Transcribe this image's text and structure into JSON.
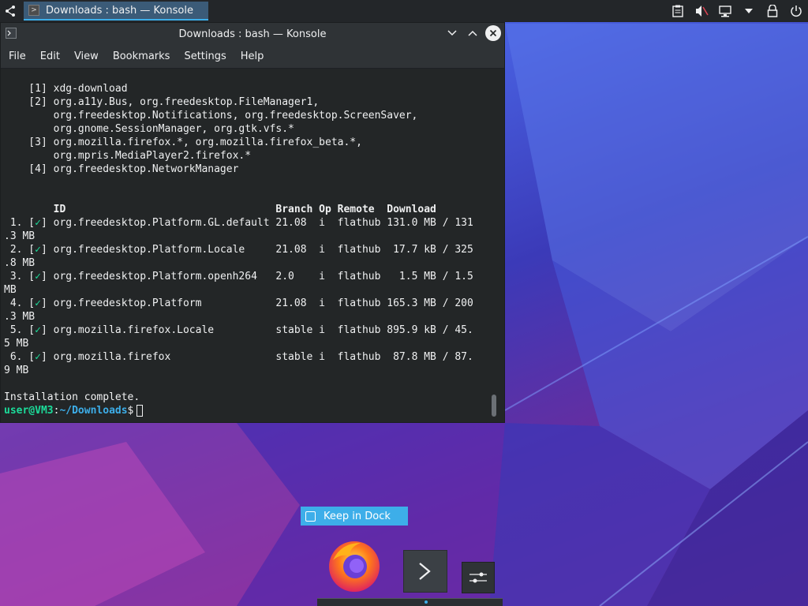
{
  "taskbar": {
    "task_title": "Downloads : bash — Konsole"
  },
  "window": {
    "title": "Downloads : bash — Konsole",
    "menu": [
      "File",
      "Edit",
      "View",
      "Bookmarks",
      "Settings",
      "Help"
    ]
  },
  "terminal": {
    "permission_lines": [
      "    [1] xdg-download",
      "    [2] org.a11y.Bus, org.freedesktop.FileManager1,",
      "        org.freedesktop.Notifications, org.freedesktop.ScreenSaver,",
      "        org.gnome.SessionManager, org.gtk.vfs.*",
      "    [3] org.mozilla.firefox.*, org.mozilla.firefox_beta.*,",
      "        org.mpris.MediaPlayer2.firefox.*",
      "    [4] org.freedesktop.NetworkManager"
    ],
    "table_header": "        ID                                  Branch Op Remote  Download",
    "rows": [
      {
        "prefix": " 1. [",
        "check": "✓",
        "text": "] org.freedesktop.Platform.GL.default 21.08  i  flathub 131.0 MB / 131",
        "wrap": ".3 MB"
      },
      {
        "prefix": " 2. [",
        "check": "✓",
        "text": "] org.freedesktop.Platform.Locale     21.08  i  flathub  17.7 kB / 325",
        "wrap": ".8 MB"
      },
      {
        "prefix": " 3. [",
        "check": "✓",
        "text": "] org.freedesktop.Platform.openh264   2.0    i  flathub   1.5 MB / 1.5",
        "wrap": "MB"
      },
      {
        "prefix": " 4. [",
        "check": "✓",
        "text": "] org.freedesktop.Platform            21.08  i  flathub 165.3 MB / 200",
        "wrap": ".3 MB"
      },
      {
        "prefix": " 5. [",
        "check": "✓",
        "text": "] org.mozilla.firefox.Locale          stable i  flathub 895.9 kB / 45.",
        "wrap": "5 MB"
      },
      {
        "prefix": " 6. [",
        "check": "✓",
        "text": "] org.mozilla.firefox                 stable i  flathub  87.8 MB / 87.",
        "wrap": "9 MB"
      }
    ],
    "status": "Installation complete.",
    "prompt_user": "user@VM3",
    "prompt_sep": ":",
    "prompt_path": "~/Downloads",
    "prompt_end": "$"
  },
  "dock": {
    "keep_in_dock_label": "Keep in Dock"
  },
  "colors": {
    "accent": "#3daee9",
    "terminal_bg": "#232627",
    "prompt_green": "#1cdc9a"
  },
  "icons": [
    "launcher-icon",
    "konsole-icon",
    "clipboard-icon",
    "volume-muted-icon",
    "network-icon",
    "tray-expand-icon",
    "lock-icon",
    "power-icon",
    "firefox-icon",
    "settings-icon"
  ]
}
